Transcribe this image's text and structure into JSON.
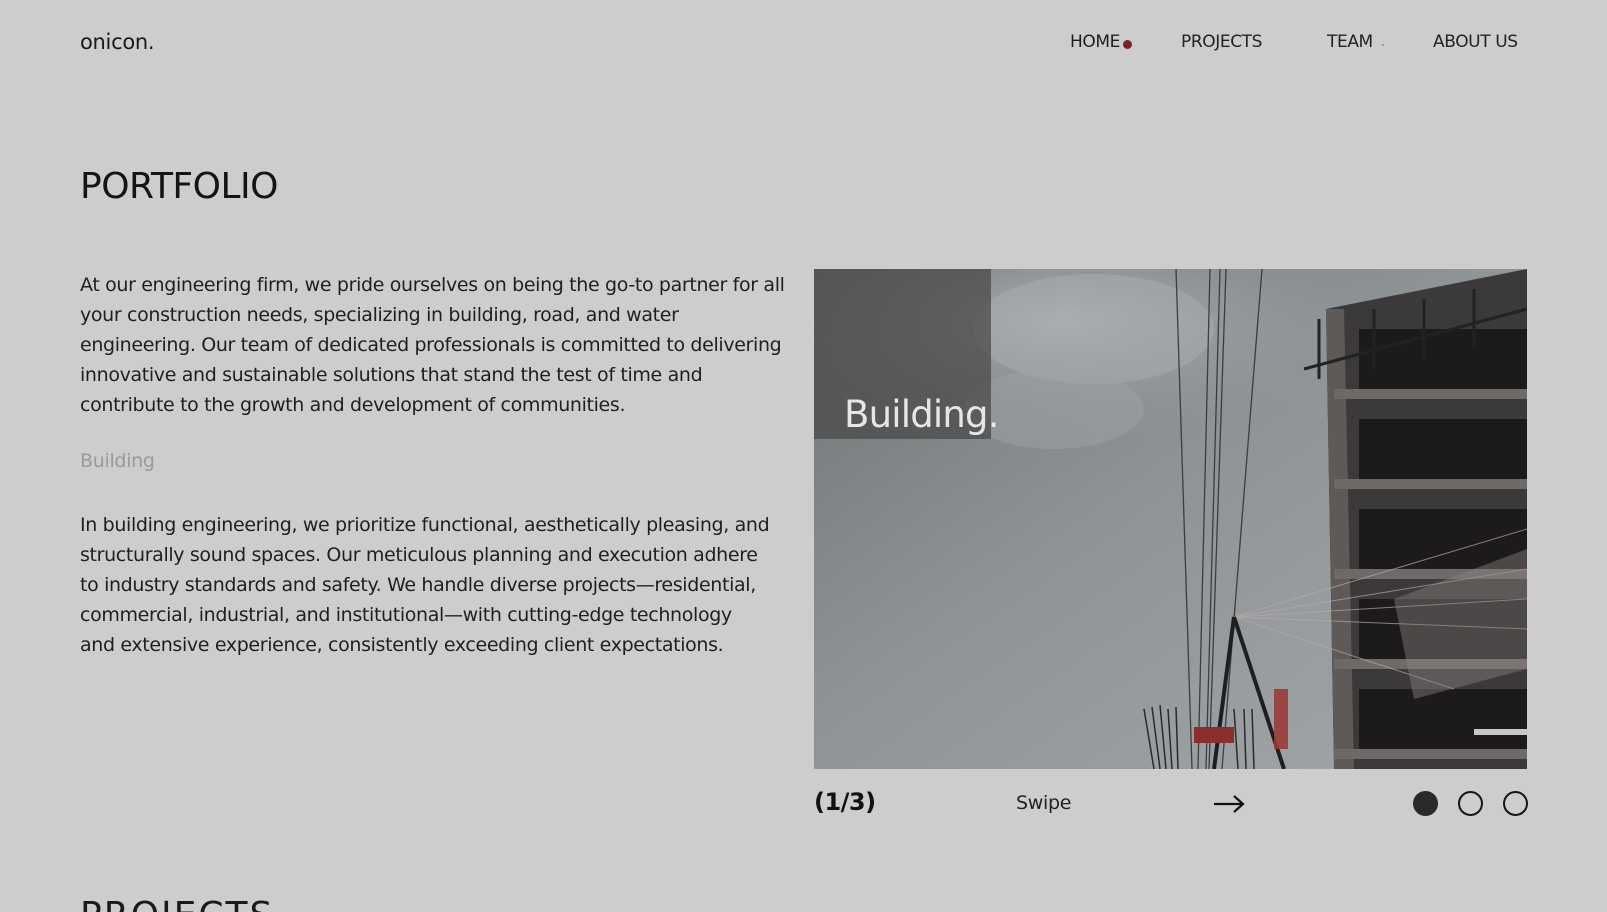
{
  "header": {
    "logo": "onicon.",
    "nav": [
      {
        "label": "HOME"
      },
      {
        "label": "PROJECTS"
      },
      {
        "label": "TEAM"
      },
      {
        "label": "ABOUT US"
      }
    ],
    "active_dot_color": "#7a2226"
  },
  "main": {
    "title": "PORTFOLIO",
    "intro": "At our engineering firm, we pride ourselves on being the go-to partner for all your construction needs, specializing in building, road, and water engineering. Our team of dedicated professionals is committed to delivering innovative and sustainable solutions that stand the test of time and contribute to the growth and development of communities.",
    "section_label": "Building",
    "section_text": "In building engineering, we prioritize functional, aesthetically pleasing, and structurally sound spaces. Our meticulous planning and execution adhere to industry standards and safety. We handle diverse projects—residential, commercial, industrial, and institutional—with cutting-edge technology and extensive experience, consistently exceeding client expectations."
  },
  "slider": {
    "caption": "Building.",
    "counter": "(1/3)",
    "swipe_label": "Swipe",
    "arrow_icon": "arrow-right-icon",
    "dots": [
      {
        "active": true
      },
      {
        "active": false
      },
      {
        "active": false
      }
    ]
  },
  "next_section": {
    "title": "PROJECTS"
  }
}
